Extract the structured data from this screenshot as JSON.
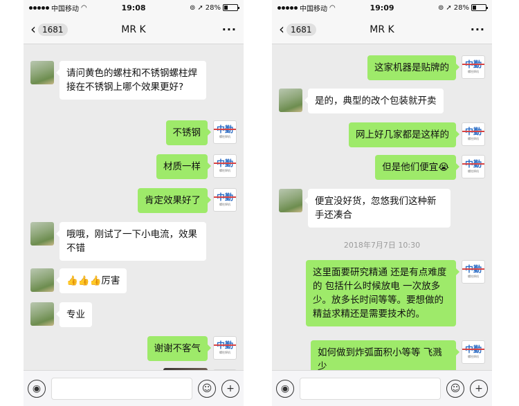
{
  "left": {
    "status": {
      "carrier": "中国移动",
      "time": "19:08",
      "battery": "28%",
      "battery_level": 0.28
    },
    "nav": {
      "back_count": "1681",
      "title": "MR K",
      "more": "···"
    },
    "messages": [
      {
        "side": "in",
        "text": "请问黄色的螺柱和不锈钢螺柱焊接在不锈钢上哪个效果更好?"
      },
      {
        "side": "out",
        "text": "不锈钢"
      },
      {
        "side": "out",
        "text": "材质一样"
      },
      {
        "side": "out",
        "text": "肯定效果好了"
      },
      {
        "side": "in",
        "text": "哦哦，刚试了一下小电流，效果不错"
      },
      {
        "side": "in",
        "text": "👍👍👍厉害"
      },
      {
        "side": "in",
        "text": "专业"
      },
      {
        "side": "out",
        "text": "谢谢不客气"
      }
    ]
  },
  "right": {
    "status": {
      "carrier": "中国移动",
      "time": "19:09",
      "battery": "28%",
      "battery_level": 0.28
    },
    "nav": {
      "back_count": "1681",
      "title": "MR K",
      "more": "···"
    },
    "messages": [
      {
        "side": "out",
        "text": "这家机器是贴牌的"
      },
      {
        "side": "in",
        "text": "是的，典型的改个包装就开卖"
      },
      {
        "side": "out",
        "text": "网上好几家都是这样的"
      },
      {
        "side": "out",
        "text": "但是他们便宜😭"
      },
      {
        "side": "in",
        "text": "便宜没好货，忽悠我们这种新手还凑合"
      },
      {
        "side": "out",
        "text": "这里面要研究精通 还是有点难度的 包括什么时候放电 一次放多少。放多长时间等等。要想做的精益求精还是需要技术的。"
      },
      {
        "side": "out",
        "text": "如何做到炸弧面积小等等 飞溅少"
      }
    ],
    "timestamp": "2018年7月7日 10:30"
  },
  "brand_avatar": {
    "main": "中勤",
    "sub": "螺柱焊机"
  },
  "input_bar": {
    "voice_icon": "voice-icon",
    "emoji_icon": "emoji-icon",
    "plus_icon": "plus-icon"
  },
  "colors": {
    "outgoing_bubble": "#9eea6a",
    "incoming_bubble": "#ffffff",
    "chat_bg": "#ebebeb"
  }
}
